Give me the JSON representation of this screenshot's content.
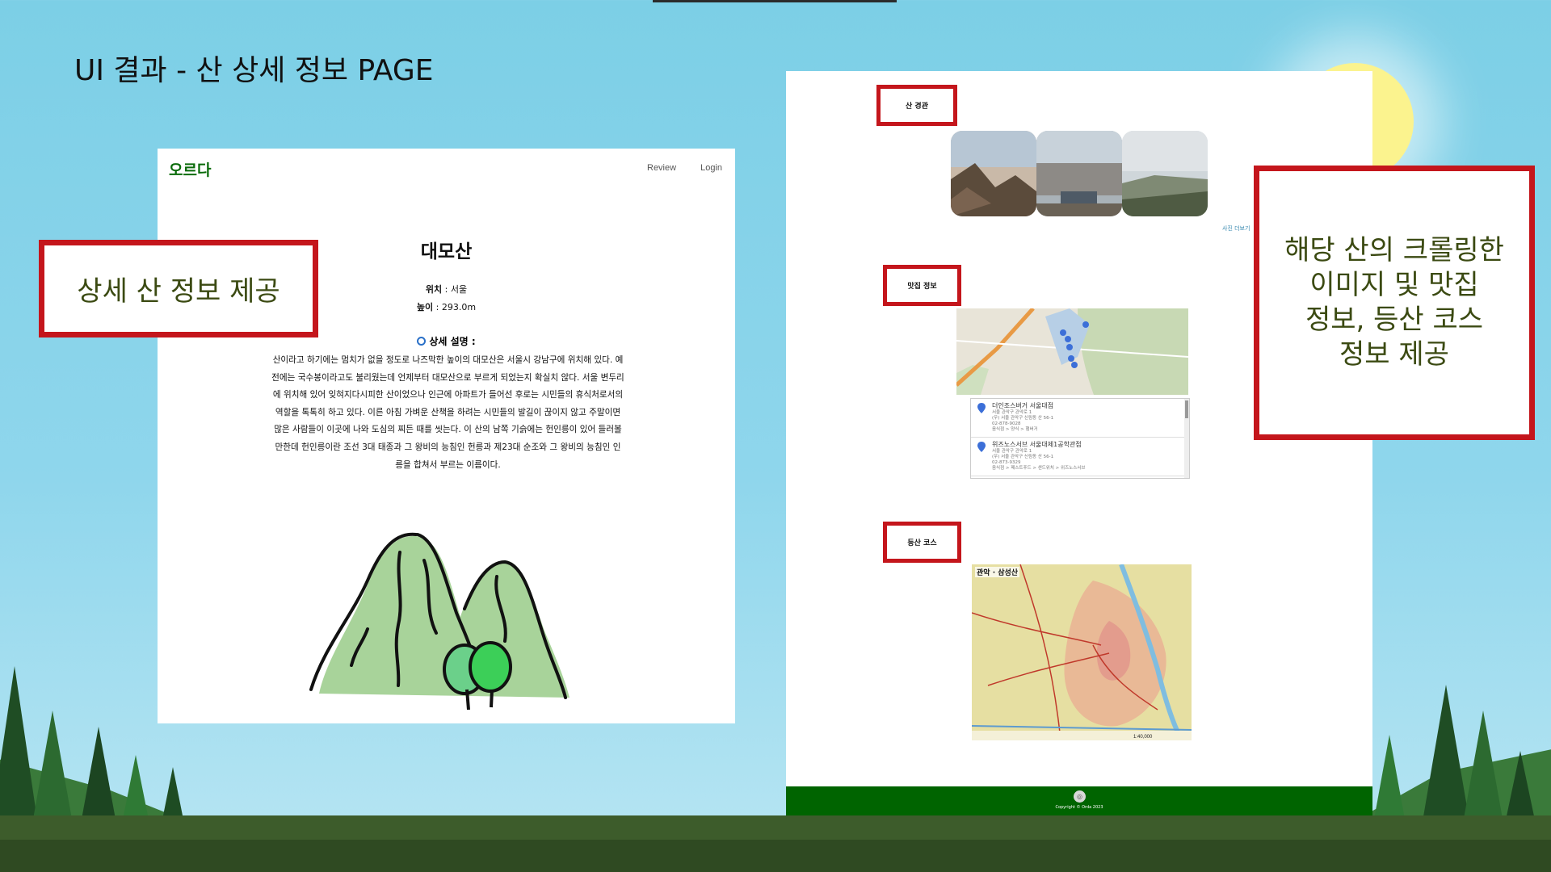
{
  "slide": {
    "title": "UI 결과 -  산 상세 정보 PAGE"
  },
  "left_screen": {
    "logo": "오르다",
    "nav": [
      "Review",
      "Login"
    ],
    "mountain_name": "대모산",
    "location_label": "위치",
    "location_value": " : 서울",
    "height_label": "높이",
    "height_value": " : 293.0m",
    "desc_icon": "search-icon",
    "desc_title": "상세 설명 :",
    "desc_lines": [
      "산이라고 하기에는 멈치가 없을 정도로 나즈막한 높이의 대모산은 서울시 강남구에 위치해 있다. 예",
      "전에는 국수봉이라고도 불리웠는데 언제부터 대모산으로 부르게 되었는지 확실치 않다. 서울 변두리",
      "에 위치해 있어 잊혀지다시피한 산이었으나 인근에 아파트가 들어선 후로는 시민들의 휴식처로서의",
      "역할을 톡톡히 하고 있다. 이른 아침 가벼운 산책을 하려는 시민들의 발길이 끊이지 않고 주말이면",
      "많은 사람들이 이곳에 나와 도심의 찌든 때를 씻는다. 이 산의 남쪽 기슭에는 헌인릉이 있어 들러볼",
      "만한데 헌인릉이란 조선 3대 태종과 그 왕비의 능침인 헌릉과 제23대 순조와 그 왕비의 능침인 인",
      "릉을 합쳐서 부르는 이름이다."
    ]
  },
  "callouts": {
    "left": "상세 산 정보 제공",
    "right_lines": [
      "해당 산의 크롤링한",
      "이미지 및 맛집",
      "정보, 등산 코스",
      "정보 제공"
    ]
  },
  "right_screen": {
    "sections": {
      "view": "산 경관",
      "food": "맛집 정보",
      "course": "등산 코스"
    },
    "more_photos": "사진 더보기",
    "restaurants": [
      {
        "name": "더인조스버거 서울대점",
        "lines": [
          "서울 관악구 관악로 1",
          "(우) 서울 관악구 신림동 산 56-1",
          "02-878-9028",
          "음식점 > 양식 > 햄버거"
        ]
      },
      {
        "name": "위즈노스서브 서울대제1공학관점",
        "lines": [
          "서울 관악구 관악로 1",
          "(우) 서울 관악구 신림동 산 56-1",
          "02-873-9329",
          "음식점 > 패스트푸드 > 샌드위치 > 위즈노스서브"
        ]
      }
    ],
    "course_map_title": "관악 · 삼성산",
    "course_scale": "1:40,000",
    "footer_copyright": "Copyright © Orda 2023"
  },
  "colors": {
    "brand_green": "#0a6b0a",
    "footer_green": "#006400",
    "callout_red": "#c4161c",
    "callout_text": "#3b4a12"
  }
}
